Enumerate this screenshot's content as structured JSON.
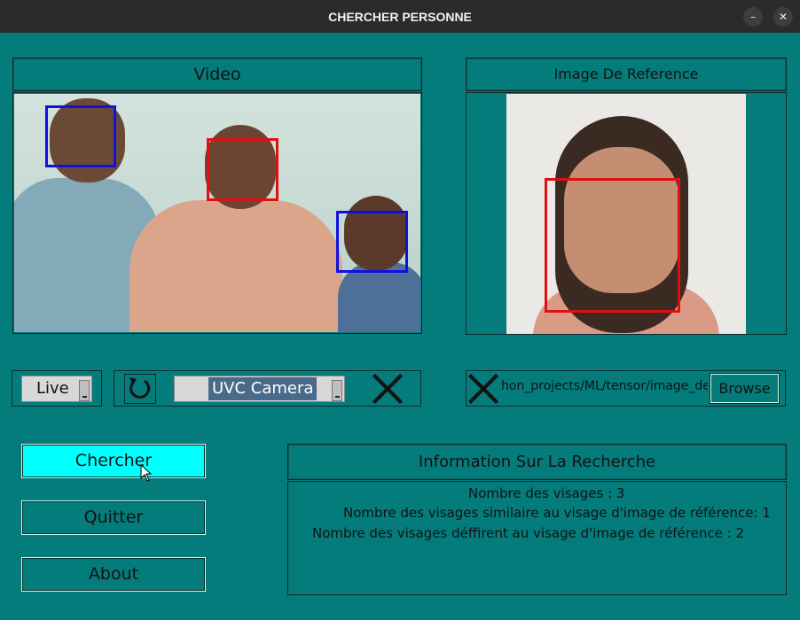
{
  "window": {
    "title": "CHERCHER PERSONNE",
    "minimize_glyph": "–",
    "close_glyph": "✕"
  },
  "video_panel": {
    "title": "Video"
  },
  "reference_panel": {
    "title": "Image De Reference"
  },
  "controls": {
    "mode_select": {
      "value": "Live"
    },
    "camera_select": {
      "value": "UVC Camera"
    },
    "refresh_icon": "refresh-icon",
    "path_field": {
      "value": "hon_projects/ML/tensor/image_dete"
    },
    "browse_label": "Browse"
  },
  "buttons": {
    "search": "Chercher",
    "quit": "Quitter",
    "about": "About"
  },
  "info_panel": {
    "title": "Information Sur La Recherche",
    "lines": [
      "Nombre des visages : 3",
      "Nombre des visages similaire au visage d'image de référence: 1",
      "Nombre des visages déffirent au visage d'image de référence : 2"
    ]
  },
  "colors": {
    "background": "#047c7c",
    "match_box": "#e01010",
    "other_box": "#1010e0",
    "active_button": "#00ffff"
  }
}
